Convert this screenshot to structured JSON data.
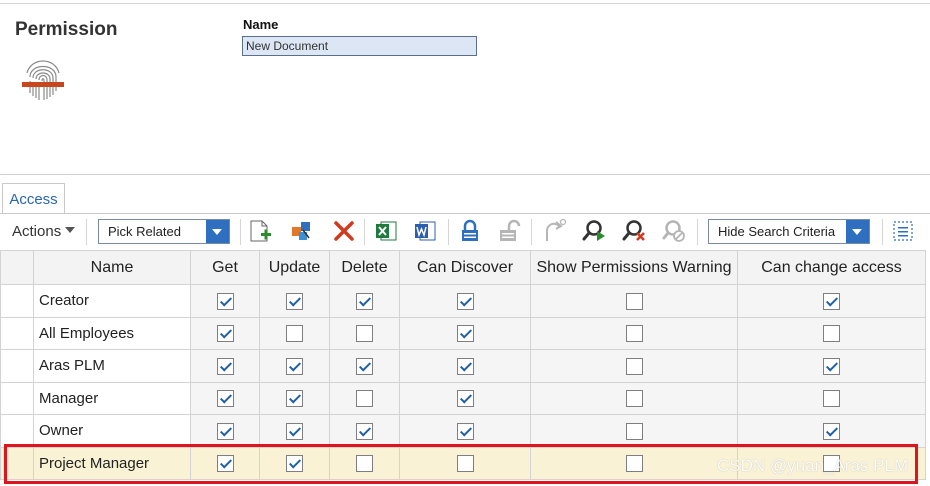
{
  "form": {
    "title": "Permission",
    "name_label": "Name",
    "name_value": "New Document"
  },
  "tabs": [
    {
      "label": "Access"
    }
  ],
  "toolbar": {
    "actions_label": "Actions",
    "pick_related_value": "Pick Related",
    "hide_search_value": "Hide Search Criteria"
  },
  "grid": {
    "headers": [
      "Name",
      "Get",
      "Update",
      "Delete",
      "Can Discover",
      "Show Permissions Warning",
      "Can change access"
    ],
    "rows": [
      {
        "name": "Creator",
        "get": true,
        "update": true,
        "delete": true,
        "can_discover": true,
        "show_warning": false,
        "can_change_access": true
      },
      {
        "name": "All Employees",
        "get": true,
        "update": false,
        "delete": false,
        "can_discover": true,
        "show_warning": false,
        "can_change_access": false
      },
      {
        "name": "Aras PLM",
        "get": true,
        "update": true,
        "delete": true,
        "can_discover": true,
        "show_warning": false,
        "can_change_access": true
      },
      {
        "name": "Manager",
        "get": true,
        "update": true,
        "delete": false,
        "can_discover": true,
        "show_warning": false,
        "can_change_access": false
      },
      {
        "name": "Owner",
        "get": true,
        "update": true,
        "delete": true,
        "can_discover": true,
        "show_warning": false,
        "can_change_access": true
      },
      {
        "name": "Project Manager",
        "get": true,
        "update": true,
        "delete": false,
        "can_discover": false,
        "show_warning": false,
        "can_change_access": false
      }
    ],
    "highlighted_row": 5
  },
  "watermark": "CSDN @yuan_Aras PLM",
  "colors": {
    "accent_blue": "#2f6fbf",
    "highlight_row": "#f9f2d4",
    "annotation_red": "#e0141c"
  }
}
